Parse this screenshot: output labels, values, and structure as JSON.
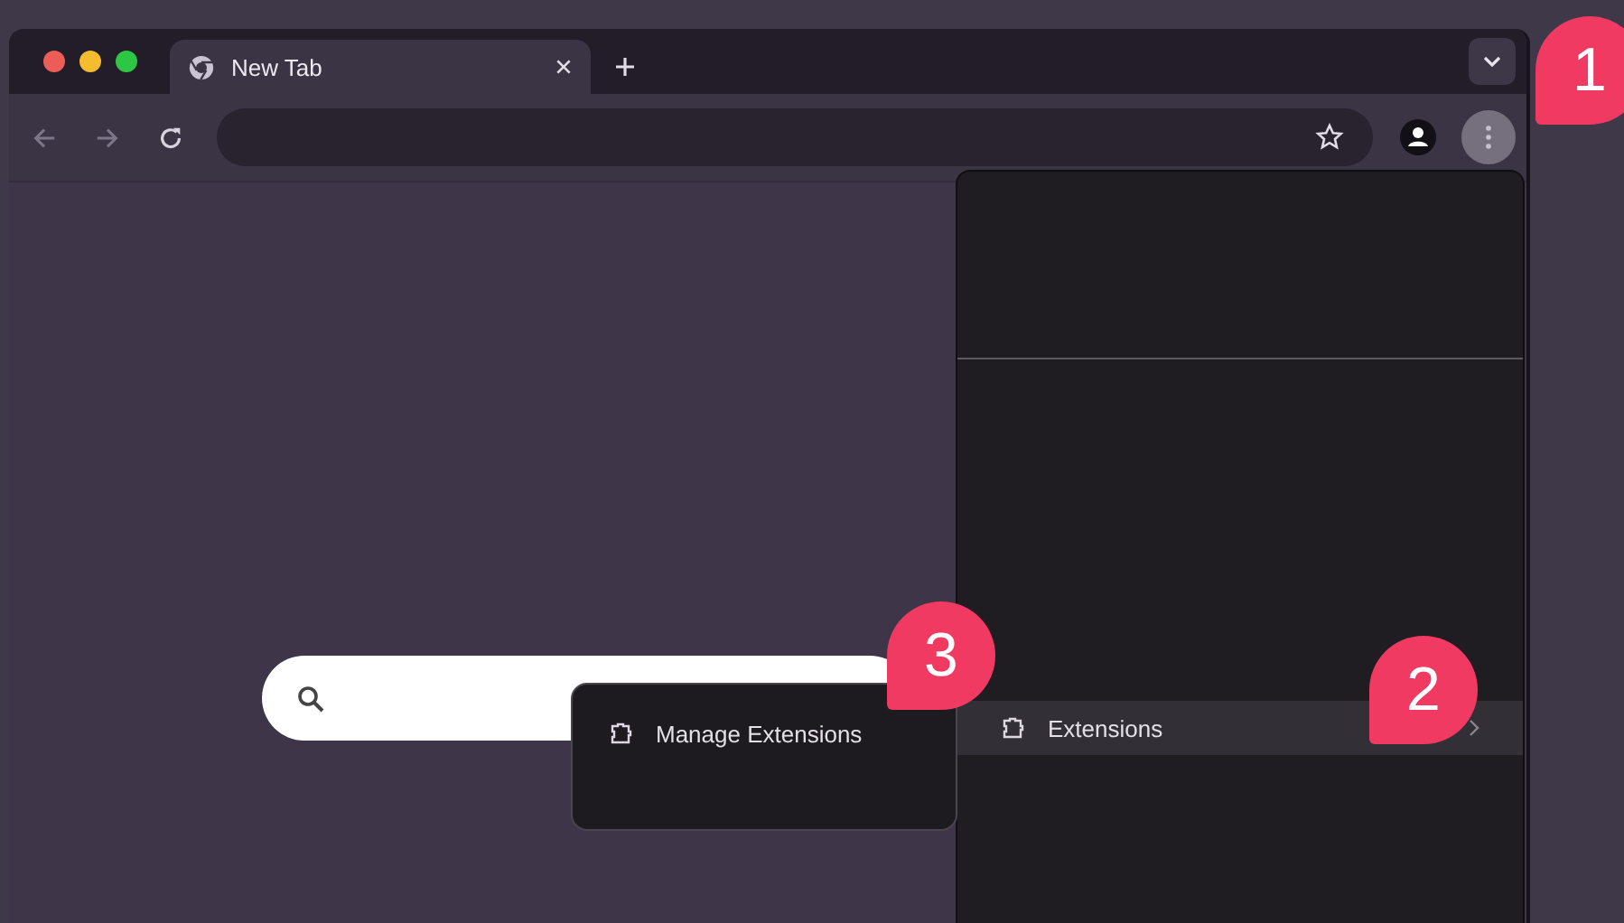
{
  "tab": {
    "title": "New Tab",
    "selected": true
  },
  "menu": {
    "items": [
      {
        "label": "Extensions",
        "selected": true,
        "has_submenu": true
      }
    ]
  },
  "submenu": {
    "items": [
      {
        "label": "Manage Extensions",
        "selected": false
      }
    ]
  },
  "callouts": [
    {
      "number": "1",
      "kind": "corner"
    },
    {
      "number": "2",
      "kind": "menu"
    },
    {
      "number": "3",
      "kind": "submenu"
    }
  ]
}
